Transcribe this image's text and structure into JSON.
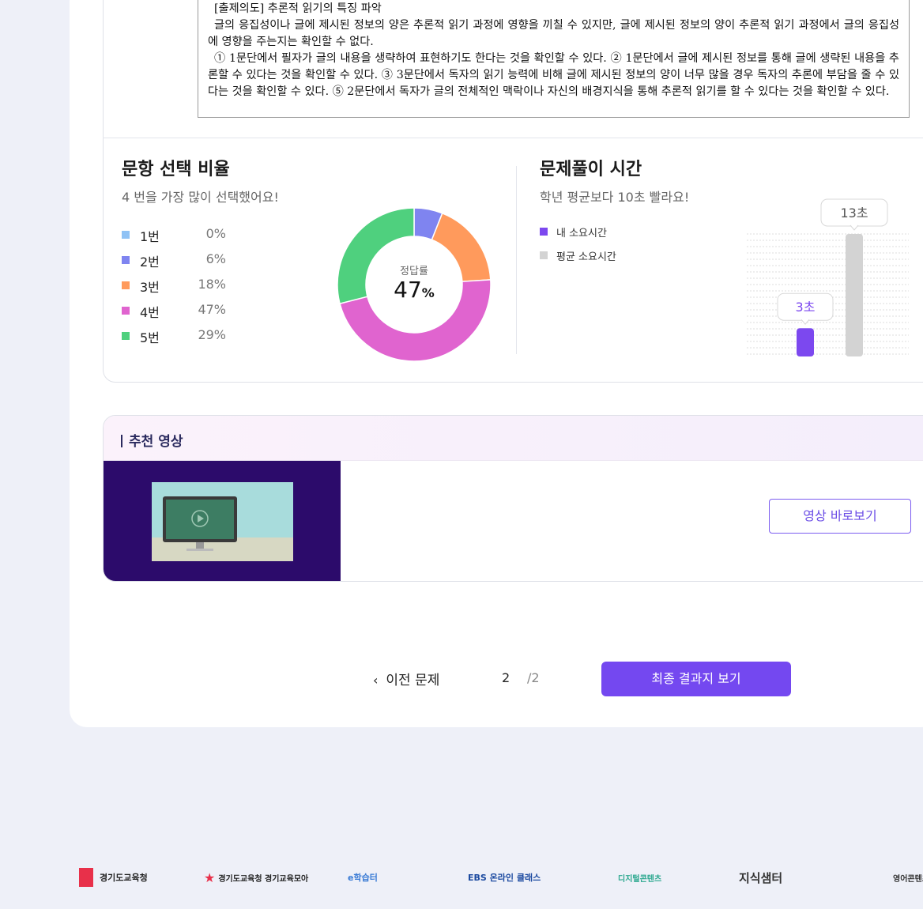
{
  "explanation": {
    "title": "[출제의도] 추론적 읽기의 특징 파악",
    "p1": "글의 응집성이나 글에 제시된 정보의 양은 추론적 읽기 과정에 영향을 끼칠 수 있지만, 글에 제시된 정보의 양이 추론적 읽기 과정에서 글의 응집성에 영향을 주는지는 확인할 수 없다.",
    "p2": "① 1문단에서 필자가 글의 내용을 생략하여 표현하기도 한다는 것을 확인할 수 있다. ② 1문단에서 글에 제시된 정보를 통해 글에 생략된 내용을 추론할 수 있다는 것을 확인할 수 있다. ③ 3문단에서 독자의 읽기 능력에 비해 글에 제시된 정보의 양이 너무 많을 경우 독자의 추론에 부담을 줄 수 있다는 것을 확인할 수 있다. ⑤ 2문단에서 독자가 글의 전체적인 맥락이나 자신의 배경지식을 통해 추론적 읽기를 할 수 있다는 것을 확인할 수 있다."
  },
  "selection": {
    "title": "문항 선택 비율",
    "subtitle": "4 번을 가장 많이 선택했어요!",
    "items": [
      {
        "label": "1번",
        "pct": "0%",
        "value": 0,
        "color": "#8fc2f5"
      },
      {
        "label": "2번",
        "pct": "6%",
        "value": 6,
        "color": "#7f84f0"
      },
      {
        "label": "3번",
        "pct": "18%",
        "value": 18,
        "color": "#ff9a5c"
      },
      {
        "label": "4번",
        "pct": "47%",
        "value": 47,
        "color": "#e064cf"
      },
      {
        "label": "5번",
        "pct": "29%",
        "value": 29,
        "color": "#4fd07e"
      }
    ],
    "center_label": "정답률",
    "center_value": "47",
    "center_unit": "%"
  },
  "time": {
    "title": "문제풀이 시간",
    "subtitle": "학년 평균보다 10초 빨라요!",
    "legend_mine": "내 소요시간",
    "legend_avg": "평균 소요시간",
    "mine_seconds": 3,
    "avg_seconds": 13,
    "mine_label": "3초",
    "avg_label": "13초",
    "mine_color": "#7c48ef",
    "avg_color": "#d3d3d3"
  },
  "recommend": {
    "title": "추천 영상",
    "watch_label": "영상 바로보기"
  },
  "pager": {
    "prev_label": "이전 문제",
    "current": "2",
    "total": "/2",
    "final_label": "최종 결과지 보기"
  },
  "footer": {
    "logos": [
      "경기도교육청",
      "경기도교육청 경기교육모아",
      "e학습터",
      "EBS 온라인 클래스",
      "디지털콘텐츠",
      "지식샘터",
      "영어콘텐츠"
    ]
  }
}
